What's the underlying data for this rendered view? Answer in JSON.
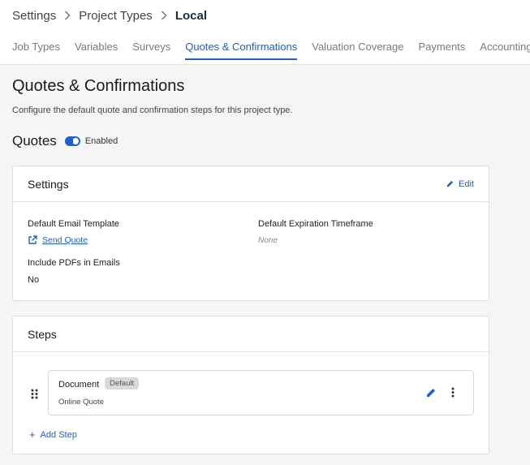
{
  "breadcrumb": {
    "items": [
      "Settings",
      "Project Types"
    ],
    "current": "Local"
  },
  "tabs": [
    {
      "label": "Job Types",
      "active": false
    },
    {
      "label": "Variables",
      "active": false
    },
    {
      "label": "Surveys",
      "active": false
    },
    {
      "label": "Quotes & Confirmations",
      "active": true
    },
    {
      "label": "Valuation Coverage",
      "active": false
    },
    {
      "label": "Payments",
      "active": false
    },
    {
      "label": "Accounting",
      "active": false
    }
  ],
  "page": {
    "title": "Quotes & Confirmations",
    "description": "Configure the default quote and confirmation steps for this project type."
  },
  "quotes": {
    "title": "Quotes",
    "toggle_label": "Enabled"
  },
  "settings_card": {
    "title": "Settings",
    "edit_label": "Edit",
    "default_email_template_label": "Default Email Template",
    "default_email_template_value": "Send Quote",
    "default_expiration_label": "Default Expiration Timeframe",
    "default_expiration_value": "None",
    "include_pdfs_label": "Include PDFs in Emails",
    "include_pdfs_value": "No"
  },
  "steps_card": {
    "title": "Steps",
    "steps": [
      {
        "name": "Document",
        "badge": "Default",
        "subtitle": "Online Quote"
      }
    ],
    "add_step_label": "Add Step"
  },
  "colors": {
    "accent": "#1d5fd6",
    "background": "#f5f5f5"
  }
}
